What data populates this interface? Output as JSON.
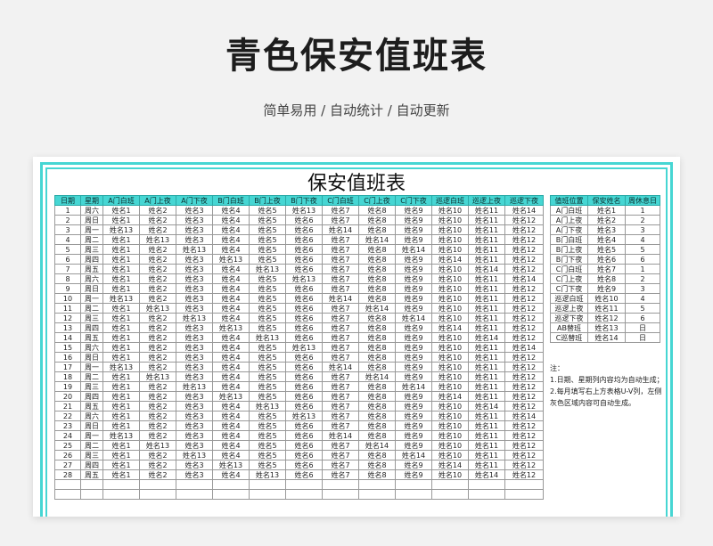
{
  "banner": {
    "title": "青色保安值班表",
    "subtitle": "简单易用 / 自动统计 / 自动更新"
  },
  "sheet": {
    "title": "保安值班表",
    "headers": [
      "日期",
      "星期",
      "A门白班",
      "A门上夜",
      "A门下夜",
      "B门白班",
      "B门上夜",
      "B门下夜",
      "C门白班",
      "C门上夜",
      "C门下夜",
      "巡逻白班",
      "巡逻上夜",
      "巡逻下夜"
    ],
    "rows": [
      [
        "1",
        "周六",
        "姓名1",
        "姓名2",
        "姓名3",
        "姓名4",
        "姓名5",
        "姓名13",
        "姓名7",
        "姓名8",
        "姓名9",
        "姓名10",
        "姓名11",
        "姓名14"
      ],
      [
        "2",
        "周日",
        "姓名1",
        "姓名2",
        "姓名3",
        "姓名4",
        "姓名5",
        "姓名6",
        "姓名7",
        "姓名8",
        "姓名9",
        "姓名10",
        "姓名11",
        "姓名12"
      ],
      [
        "3",
        "周一",
        "姓名13",
        "姓名2",
        "姓名3",
        "姓名4",
        "姓名5",
        "姓名6",
        "姓名14",
        "姓名8",
        "姓名9",
        "姓名10",
        "姓名11",
        "姓名12"
      ],
      [
        "4",
        "周二",
        "姓名1",
        "姓名13",
        "姓名3",
        "姓名4",
        "姓名5",
        "姓名6",
        "姓名7",
        "姓名14",
        "姓名9",
        "姓名10",
        "姓名11",
        "姓名12"
      ],
      [
        "5",
        "周三",
        "姓名1",
        "姓名2",
        "姓名13",
        "姓名4",
        "姓名5",
        "姓名6",
        "姓名7",
        "姓名8",
        "姓名14",
        "姓名10",
        "姓名11",
        "姓名12"
      ],
      [
        "6",
        "周四",
        "姓名1",
        "姓名2",
        "姓名3",
        "姓名13",
        "姓名5",
        "姓名6",
        "姓名7",
        "姓名8",
        "姓名9",
        "姓名14",
        "姓名11",
        "姓名12"
      ],
      [
        "7",
        "周五",
        "姓名1",
        "姓名2",
        "姓名3",
        "姓名4",
        "姓名13",
        "姓名6",
        "姓名7",
        "姓名8",
        "姓名9",
        "姓名10",
        "姓名14",
        "姓名12"
      ],
      [
        "8",
        "周六",
        "姓名1",
        "姓名2",
        "姓名3",
        "姓名4",
        "姓名5",
        "姓名13",
        "姓名7",
        "姓名8",
        "姓名9",
        "姓名10",
        "姓名11",
        "姓名14"
      ],
      [
        "9",
        "周日",
        "姓名1",
        "姓名2",
        "姓名3",
        "姓名4",
        "姓名5",
        "姓名6",
        "姓名7",
        "姓名8",
        "姓名9",
        "姓名10",
        "姓名11",
        "姓名12"
      ],
      [
        "10",
        "周一",
        "姓名13",
        "姓名2",
        "姓名3",
        "姓名4",
        "姓名5",
        "姓名6",
        "姓名14",
        "姓名8",
        "姓名9",
        "姓名10",
        "姓名11",
        "姓名12"
      ],
      [
        "11",
        "周二",
        "姓名1",
        "姓名13",
        "姓名3",
        "姓名4",
        "姓名5",
        "姓名6",
        "姓名7",
        "姓名14",
        "姓名9",
        "姓名10",
        "姓名11",
        "姓名12"
      ],
      [
        "12",
        "周三",
        "姓名1",
        "姓名2",
        "姓名13",
        "姓名4",
        "姓名5",
        "姓名6",
        "姓名7",
        "姓名8",
        "姓名14",
        "姓名10",
        "姓名11",
        "姓名12"
      ],
      [
        "13",
        "周四",
        "姓名1",
        "姓名2",
        "姓名3",
        "姓名13",
        "姓名5",
        "姓名6",
        "姓名7",
        "姓名8",
        "姓名9",
        "姓名14",
        "姓名11",
        "姓名12"
      ],
      [
        "14",
        "周五",
        "姓名1",
        "姓名2",
        "姓名3",
        "姓名4",
        "姓名13",
        "姓名6",
        "姓名7",
        "姓名8",
        "姓名9",
        "姓名10",
        "姓名14",
        "姓名12"
      ],
      [
        "15",
        "周六",
        "姓名1",
        "姓名2",
        "姓名3",
        "姓名4",
        "姓名5",
        "姓名13",
        "姓名7",
        "姓名8",
        "姓名9",
        "姓名10",
        "姓名11",
        "姓名14"
      ],
      [
        "16",
        "周日",
        "姓名1",
        "姓名2",
        "姓名3",
        "姓名4",
        "姓名5",
        "姓名6",
        "姓名7",
        "姓名8",
        "姓名9",
        "姓名10",
        "姓名11",
        "姓名12"
      ],
      [
        "17",
        "周一",
        "姓名13",
        "姓名2",
        "姓名3",
        "姓名4",
        "姓名5",
        "姓名6",
        "姓名14",
        "姓名8",
        "姓名9",
        "姓名10",
        "姓名11",
        "姓名12"
      ],
      [
        "18",
        "周二",
        "姓名1",
        "姓名13",
        "姓名3",
        "姓名4",
        "姓名5",
        "姓名6",
        "姓名7",
        "姓名14",
        "姓名9",
        "姓名10",
        "姓名11",
        "姓名12"
      ],
      [
        "19",
        "周三",
        "姓名1",
        "姓名2",
        "姓名13",
        "姓名4",
        "姓名5",
        "姓名6",
        "姓名7",
        "姓名8",
        "姓名14",
        "姓名10",
        "姓名11",
        "姓名12"
      ],
      [
        "20",
        "周四",
        "姓名1",
        "姓名2",
        "姓名3",
        "姓名13",
        "姓名5",
        "姓名6",
        "姓名7",
        "姓名8",
        "姓名9",
        "姓名14",
        "姓名11",
        "姓名12"
      ],
      [
        "21",
        "周五",
        "姓名1",
        "姓名2",
        "姓名3",
        "姓名4",
        "姓名13",
        "姓名6",
        "姓名7",
        "姓名8",
        "姓名9",
        "姓名10",
        "姓名14",
        "姓名12"
      ],
      [
        "22",
        "周六",
        "姓名1",
        "姓名2",
        "姓名3",
        "姓名4",
        "姓名5",
        "姓名13",
        "姓名7",
        "姓名8",
        "姓名9",
        "姓名10",
        "姓名11",
        "姓名14"
      ],
      [
        "23",
        "周日",
        "姓名1",
        "姓名2",
        "姓名3",
        "姓名4",
        "姓名5",
        "姓名6",
        "姓名7",
        "姓名8",
        "姓名9",
        "姓名10",
        "姓名11",
        "姓名12"
      ],
      [
        "24",
        "周一",
        "姓名13",
        "姓名2",
        "姓名3",
        "姓名4",
        "姓名5",
        "姓名6",
        "姓名14",
        "姓名8",
        "姓名9",
        "姓名10",
        "姓名11",
        "姓名12"
      ],
      [
        "25",
        "周二",
        "姓名1",
        "姓名13",
        "姓名3",
        "姓名4",
        "姓名5",
        "姓名6",
        "姓名7",
        "姓名14",
        "姓名9",
        "姓名10",
        "姓名11",
        "姓名12"
      ],
      [
        "26",
        "周三",
        "姓名1",
        "姓名2",
        "姓名13",
        "姓名4",
        "姓名5",
        "姓名6",
        "姓名7",
        "姓名8",
        "姓名14",
        "姓名10",
        "姓名11",
        "姓名12"
      ],
      [
        "27",
        "周四",
        "姓名1",
        "姓名2",
        "姓名3",
        "姓名13",
        "姓名5",
        "姓名6",
        "姓名7",
        "姓名8",
        "姓名9",
        "姓名14",
        "姓名11",
        "姓名12"
      ],
      [
        "28",
        "周五",
        "姓名1",
        "姓名2",
        "姓名3",
        "姓名4",
        "姓名13",
        "姓名6",
        "姓名7",
        "姓名8",
        "姓名9",
        "姓名10",
        "姓名14",
        "姓名12"
      ],
      [
        "",
        "",
        "",
        "",
        "",
        "",
        "",
        "",
        "",
        "",
        "",
        "",
        "",
        ""
      ],
      [
        "",
        "",
        "",
        "",
        "",
        "",
        "",
        "",
        "",
        "",
        "",
        "",
        "",
        ""
      ]
    ]
  },
  "side_table": {
    "headers": [
      "值班位置",
      "保安姓名",
      "周休息日"
    ],
    "rows": [
      [
        "A门白班",
        "姓名1",
        "1"
      ],
      [
        "A门上夜",
        "姓名2",
        "2"
      ],
      [
        "A门下夜",
        "姓名3",
        "3"
      ],
      [
        "B门白班",
        "姓名4",
        "4"
      ],
      [
        "B门上夜",
        "姓名5",
        "5"
      ],
      [
        "B门下夜",
        "姓名6",
        "6"
      ],
      [
        "C门白班",
        "姓名7",
        "1"
      ],
      [
        "C门上夜",
        "姓名8",
        "2"
      ],
      [
        "C门下夜",
        "姓名9",
        "3"
      ],
      [
        "巡逻白班",
        "姓名10",
        "4"
      ],
      [
        "巡逻上夜",
        "姓名11",
        "5"
      ],
      [
        "巡逻下夜",
        "姓名12",
        "6"
      ],
      [
        "AB替班",
        "姓名13",
        "日"
      ],
      [
        "C巡替班",
        "姓名14",
        "日"
      ]
    ]
  },
  "notes": {
    "heading": "注：",
    "line1": "1.日期、星期列内容均为自动生成；",
    "line2": "2.每月填写右上方表格U-V列，左侧灰色区域内容可自动生成。"
  },
  "colors": {
    "accent": "#46d6d3",
    "background": "#f2f2f2"
  }
}
